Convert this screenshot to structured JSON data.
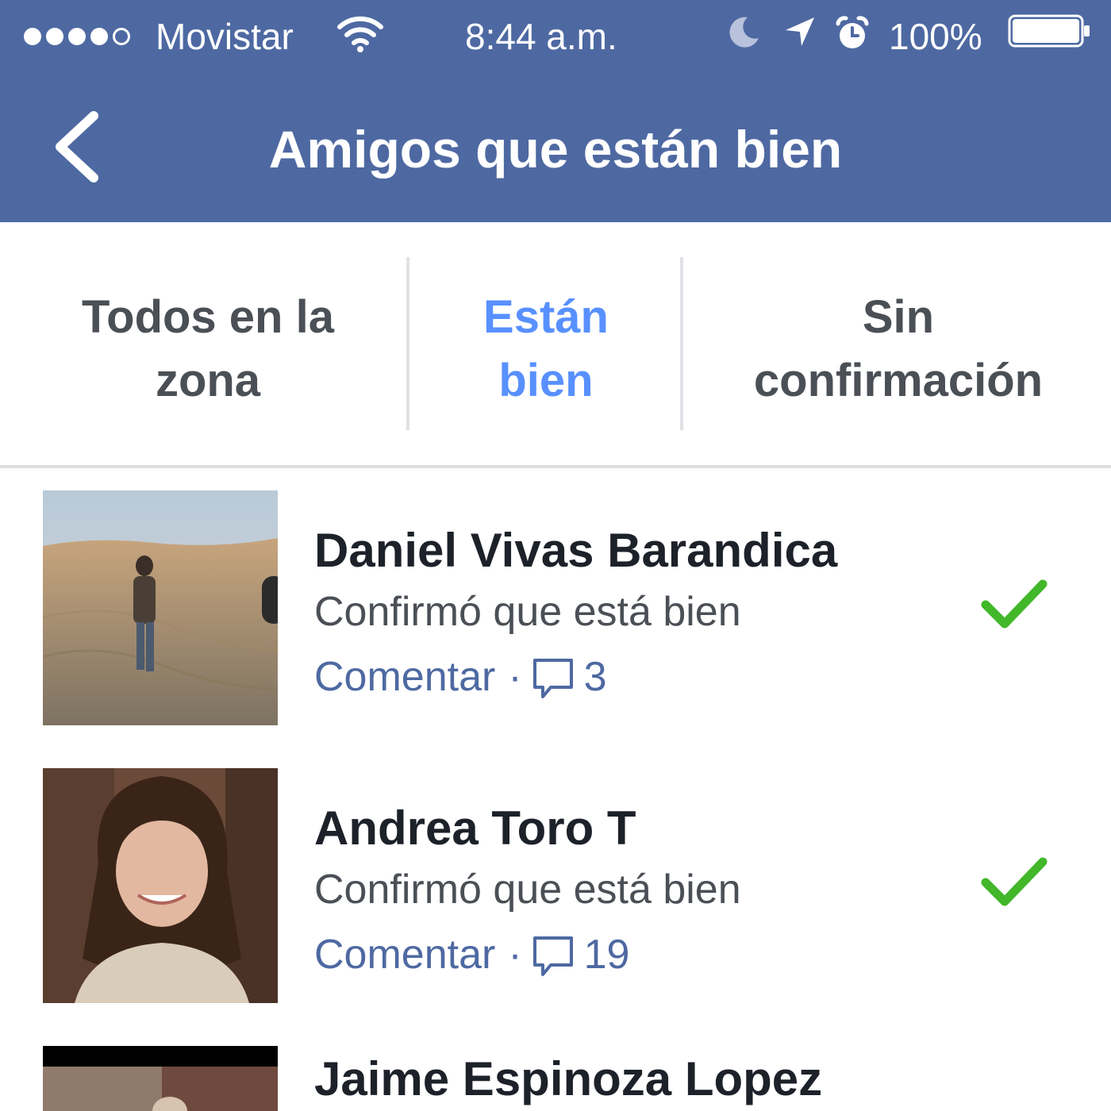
{
  "status_bar": {
    "signal_filled": 4,
    "signal_total": 5,
    "carrier": "Movistar",
    "time": "8:44 a.m.",
    "battery_percent": "100%",
    "battery_level": 1.0
  },
  "nav": {
    "back_icon": "chevron-left-icon",
    "title": "Amigos que están bien"
  },
  "tabs": [
    {
      "label_line1": "Todos en la",
      "label_line2": "zona",
      "active": false
    },
    {
      "label_line1": "Están",
      "label_line2": "bien",
      "active": true
    },
    {
      "label_line1": "Sin",
      "label_line2": "confirmación",
      "active": false
    }
  ],
  "friends": [
    {
      "name": "Daniel Vivas Barandica",
      "status": "Confirmó que está bien",
      "comment_label": "Comentar",
      "separator": "·",
      "comment_count": "3",
      "confirmed": true
    },
    {
      "name": "Andrea Toro T",
      "status": "Confirmó que está bien",
      "comment_label": "Comentar",
      "separator": "·",
      "comment_count": "19",
      "confirmed": true
    },
    {
      "name": "Jaime Espinoza Lopez"
    }
  ],
  "colors": {
    "header_blue": "#4e69a2",
    "active_tab": "#5890ff",
    "check_green": "#42b72a",
    "link_blue": "#4e69a2"
  }
}
